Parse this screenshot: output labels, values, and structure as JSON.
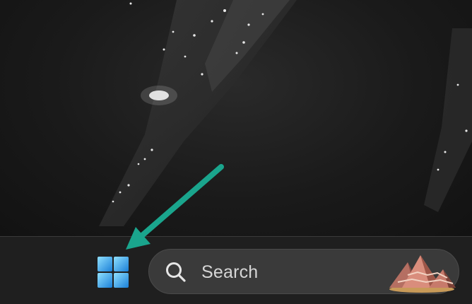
{
  "taskbar": {
    "start_button": {
      "icon": "windows-logo-icon"
    },
    "search": {
      "icon": "search-icon",
      "label": "Search",
      "highlight_icon": "search-highlight-mountains-icon"
    }
  },
  "annotation": {
    "arrow_color": "#1aa58d",
    "points_to": "start-button"
  },
  "colors": {
    "taskbar_bg": "#1f1f1f",
    "search_bg": "#3a3a3a",
    "windows_logo_light": "#8fe0ff",
    "windows_logo_dark": "#1a7fd6"
  }
}
